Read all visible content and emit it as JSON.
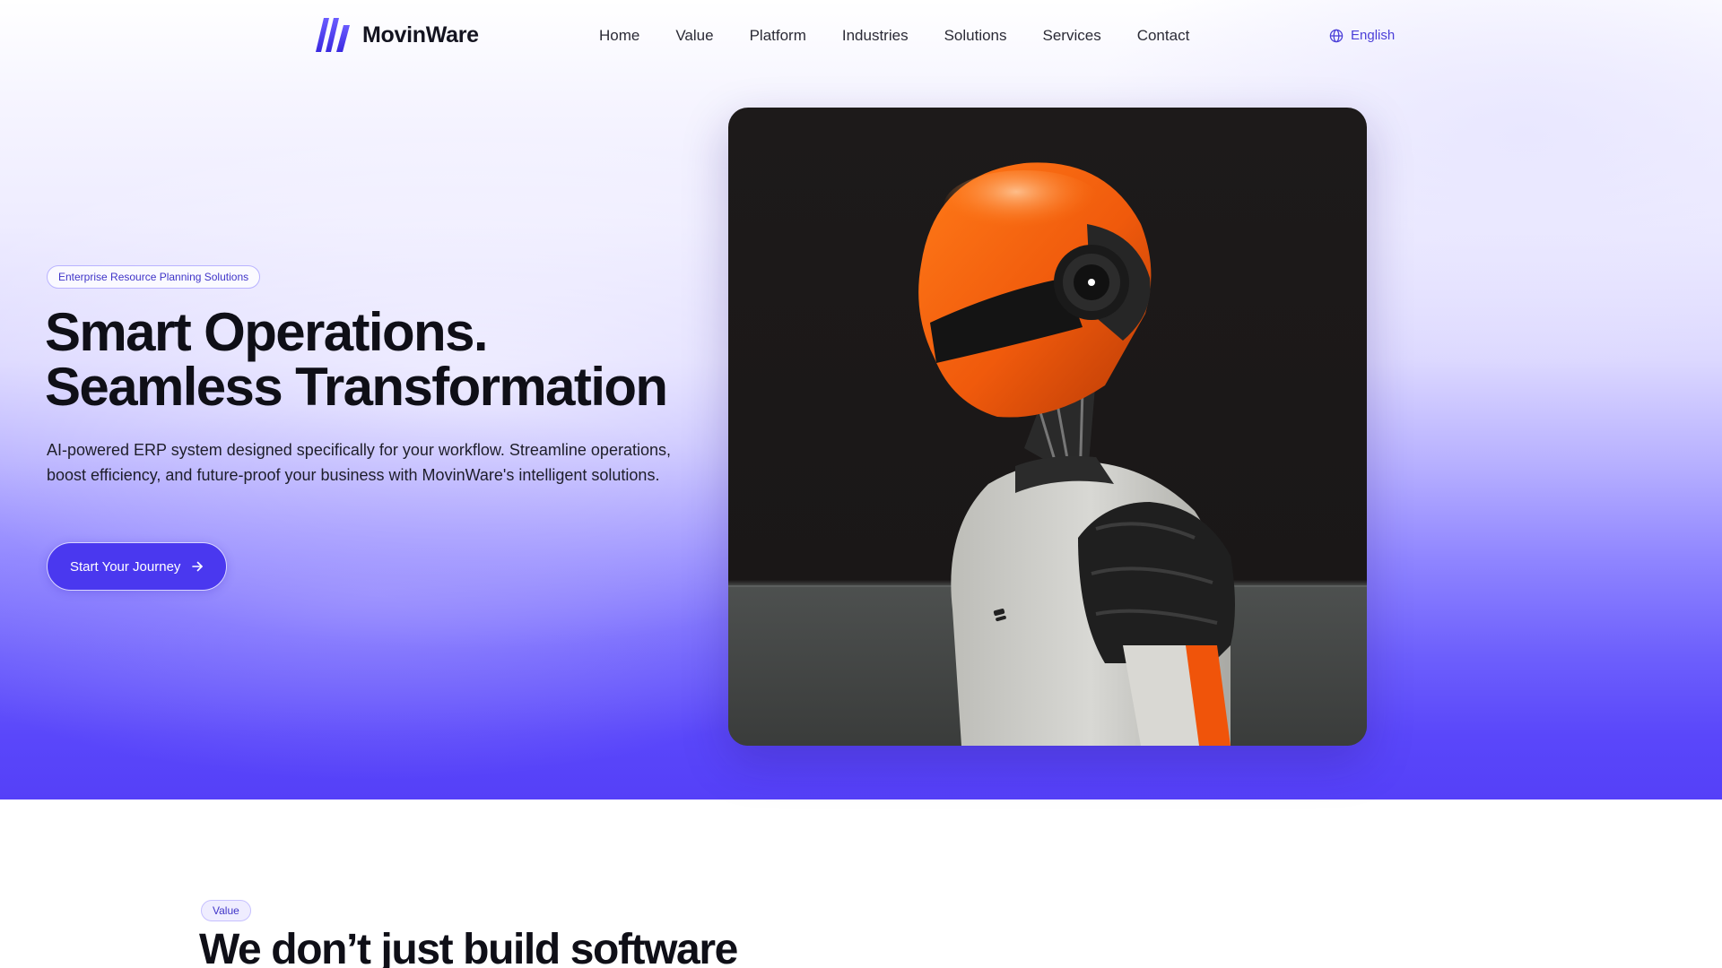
{
  "brand": {
    "name": "MovinWare",
    "accent": "#4a38ef",
    "logo_icon": "slanted-stripes-logo-icon"
  },
  "nav": {
    "items": [
      {
        "label": "Home"
      },
      {
        "label": "Value"
      },
      {
        "label": "Platform"
      },
      {
        "label": "Industries"
      },
      {
        "label": "Solutions"
      },
      {
        "label": "Services"
      },
      {
        "label": "Contact"
      }
    ],
    "language": {
      "label": "English",
      "icon": "globe-icon"
    }
  },
  "hero": {
    "badge": "Enterprise Resource Planning Solutions",
    "title_line1": "Smart Operations.",
    "title_line2": "Seamless Transformation",
    "subtitle": "AI-powered ERP system designed specifically for your workflow. Streamline operations, boost efficiency, and future-proof your business with MovinWare's intelligent solutions.",
    "cta_label": "Start Your Journey",
    "cta_icon": "arrow-right-icon",
    "image_subject": "robot-with-orange-helmet-image"
  },
  "value_section": {
    "badge": "Value",
    "title": "We don’t just build software"
  }
}
